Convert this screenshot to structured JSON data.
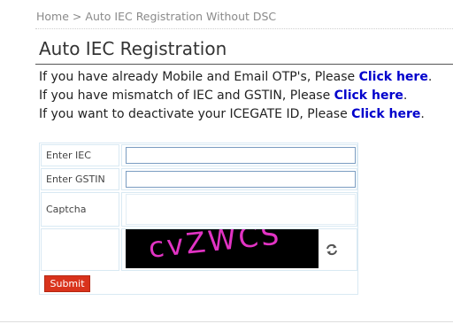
{
  "breadcrumb": {
    "home": "Home",
    "separator": ">",
    "current": "Auto IEC Registration Without DSC"
  },
  "page": {
    "title": "Auto IEC Registration"
  },
  "info_lines": [
    {
      "text": "If you have already Mobile and Email OTP's, Please ",
      "link": "Click here",
      "suffix": "."
    },
    {
      "text": "If you have mismatch of IEC and GSTIN, Please ",
      "link": "Click here",
      "suffix": "."
    },
    {
      "text": "If you want to deactivate your ICEGATE ID, Please ",
      "link": "Click here",
      "suffix": "."
    }
  ],
  "form": {
    "iec_label": "Enter IEC",
    "iec_value": "",
    "gstin_label": "Enter GSTIN",
    "gstin_value": "",
    "captcha_label": "Captcha",
    "captcha_value": "",
    "captcha_image_text": "cvZWCS",
    "refresh_icon": "refresh-icon",
    "submit_label": "Submit"
  },
  "colors": {
    "link": "#0000cc",
    "submit_bg": "#d9331c",
    "captcha_text": "#e233c4"
  }
}
